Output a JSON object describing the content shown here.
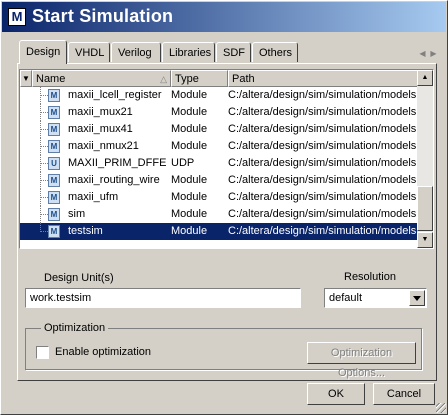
{
  "window": {
    "title": "Start Simulation",
    "app_icon_letter": "M"
  },
  "tabs": [
    {
      "label": "Design",
      "active": true
    },
    {
      "label": "VHDL"
    },
    {
      "label": "Verilog"
    },
    {
      "label": "Libraries"
    },
    {
      "label": "SDF"
    },
    {
      "label": "Others"
    }
  ],
  "list": {
    "columns": [
      "Name",
      "Type",
      "Path"
    ],
    "rows": [
      {
        "icon": "M",
        "name": "maxii_lcell_register",
        "type": "Module",
        "path": "C:/altera/design/sim/simulation/models"
      },
      {
        "icon": "M",
        "name": "maxii_mux21",
        "type": "Module",
        "path": "C:/altera/design/sim/simulation/models"
      },
      {
        "icon": "M",
        "name": "maxii_mux41",
        "type": "Module",
        "path": "C:/altera/design/sim/simulation/models"
      },
      {
        "icon": "M",
        "name": "maxii_nmux21",
        "type": "Module",
        "path": "C:/altera/design/sim/simulation/models"
      },
      {
        "icon": "U",
        "name": "MAXII_PRIM_DFFE",
        "type": "UDP",
        "path": "C:/altera/design/sim/simulation/models"
      },
      {
        "icon": "M",
        "name": "maxii_routing_wire",
        "type": "Module",
        "path": "C:/altera/design/sim/simulation/models"
      },
      {
        "icon": "M",
        "name": "maxii_ufm",
        "type": "Module",
        "path": "C:/altera/design/sim/simulation/models"
      },
      {
        "icon": "M",
        "name": "sim",
        "type": "Module",
        "path": "C:/altera/design/sim/simulation/models"
      },
      {
        "icon": "M",
        "name": "testsim",
        "type": "Module",
        "path": "C:/altera/design/sim/simulation/models",
        "selected": true
      }
    ]
  },
  "design_unit": {
    "legend": "Design Unit(s)",
    "value": "work.testsim"
  },
  "resolution": {
    "legend": "Resolution",
    "value": "default"
  },
  "optimization": {
    "legend": "Optimization",
    "enable_label": "Enable optimization",
    "enabled": false,
    "options_button": "Optimization Options..."
  },
  "buttons": {
    "ok": "OK",
    "cancel": "Cancel"
  }
}
